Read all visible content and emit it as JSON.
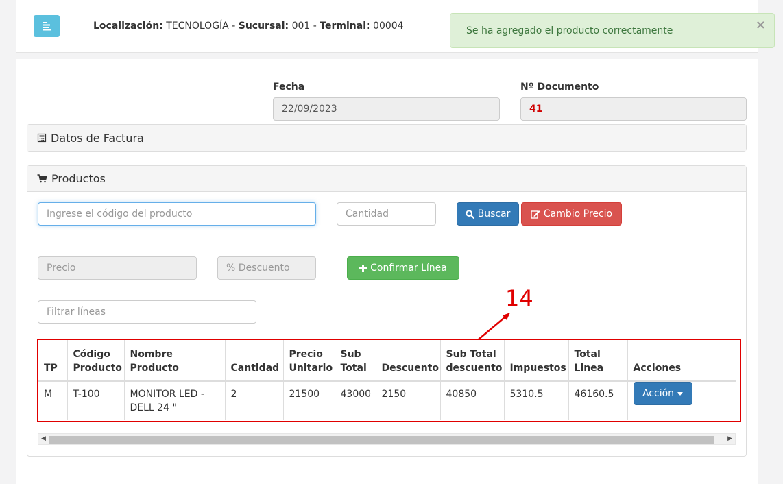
{
  "header": {
    "menu_icon": "menu-lines-icon",
    "loc_label": "Localización:",
    "loc_value": "TECNOLOGÍA",
    "sep1": "-",
    "suc_label": "Sucursal:",
    "suc_value": "001",
    "sep2": "-",
    "term_label": "Terminal:",
    "term_value": "00004"
  },
  "toast": {
    "message": "Se ha agregado el producto correctamente",
    "close": "×"
  },
  "document": {
    "fecha_label": "Fecha",
    "fecha_value": "22/09/2023",
    "num_label": "Nº Documento",
    "num_value": "41"
  },
  "sections": {
    "factura_title": "Datos de Factura",
    "productos_title": "Productos"
  },
  "form": {
    "codigo_placeholder": "Ingrese el código del producto",
    "cantidad_placeholder": "Cantidad",
    "buscar_label": "Buscar",
    "cambio_label": "Cambio Precio",
    "precio_placeholder": "Precio",
    "descuento_placeholder": "% Descuento",
    "confirmar_label": "Confirmar Línea",
    "filtrar_placeholder": "Filtrar líneas"
  },
  "table": {
    "headers": [
      [
        "TP"
      ],
      [
        "Código",
        "Producto"
      ],
      [
        "Nombre Producto"
      ],
      [
        "Cantidad"
      ],
      [
        "Precio",
        "Unitario"
      ],
      [
        "Sub",
        "Total"
      ],
      [
        "Descuento"
      ],
      [
        "Sub Total",
        "descuento"
      ],
      [
        "Impuestos"
      ],
      [
        "Total",
        "Linea"
      ],
      [
        "Acciones"
      ]
    ],
    "rows": [
      {
        "tp": "M",
        "codigo": "T-100",
        "nombre": "MONITOR LED - DELL 24 \"",
        "cantidad": "2",
        "precio": "21500",
        "subtotal": "43000",
        "descuento": "2150",
        "subtotal_desc": "40850",
        "impuestos": "5310.5",
        "total": "46160.5",
        "accion_label": "Acción"
      }
    ]
  },
  "annotation": {
    "label": "14"
  },
  "colors": {
    "accent": "#337ab7",
    "danger": "#d9534f",
    "success": "#5cb85c",
    "info": "#5bc0de",
    "annotation": "#e00000",
    "doc_number": "#d00000"
  }
}
